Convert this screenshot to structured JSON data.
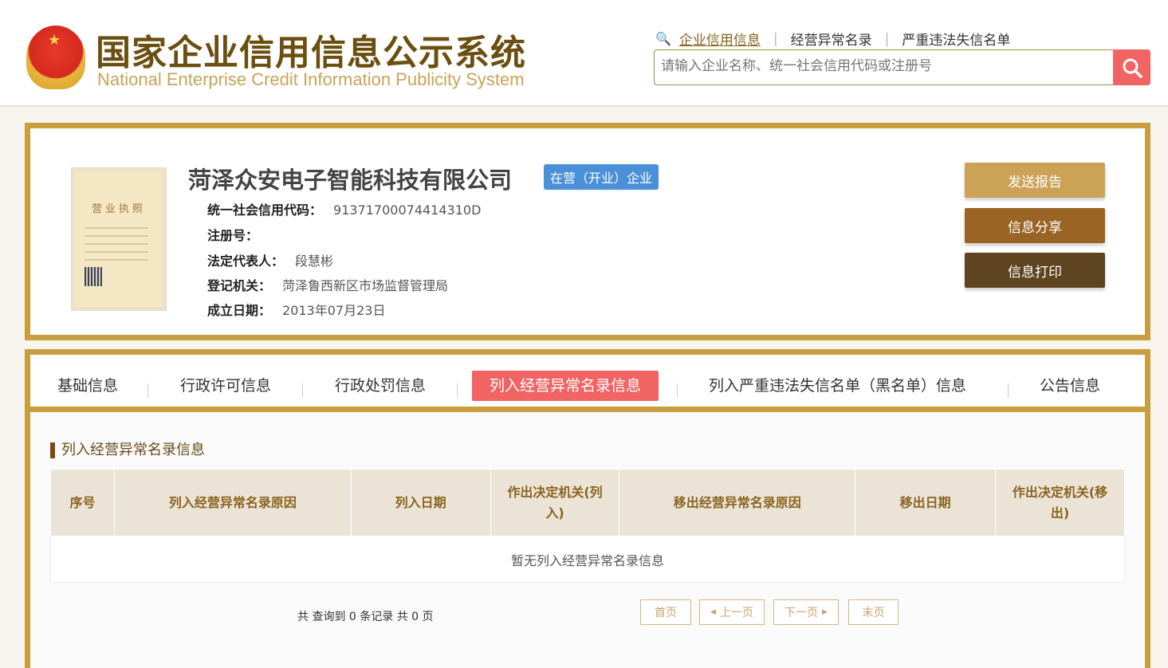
{
  "header": {
    "logo_cn": "国家企业信用信息公示系统",
    "logo_en": "National Enterprise Credit Information Publicity System",
    "nav": [
      "企业信用信息",
      "经营异常名录",
      "严重违法失信名单"
    ],
    "search_placeholder": "请输入企业名称、统一社会信用代码或注册号"
  },
  "company": {
    "license_title": "营业执照",
    "name": "菏泽众安电子智能科技有限公司",
    "status": "在营（开业）企业",
    "fields": [
      {
        "label": "统一社会信用代码：",
        "value": "91371700074414310D"
      },
      {
        "label": "注册号：",
        "value": ""
      },
      {
        "label": "法定代表人：",
        "value": "段慧彬"
      },
      {
        "label": "登记机关：",
        "value": "菏泽鲁西新区市场监督管理局"
      },
      {
        "label": "成立日期：",
        "value": "2013年07月23日"
      }
    ],
    "buttons": [
      "发送报告",
      "信息分享",
      "信息打印"
    ]
  },
  "tabs": [
    "基础信息",
    "行政许可信息",
    "行政处罚信息",
    "列入经营异常名录信息",
    "列入严重违法失信名单（黑名单）信息",
    "公告信息"
  ],
  "section": {
    "title": "列入经营异常名录信息",
    "columns": [
      "序号",
      "列入经营异常名录原因",
      "列入日期",
      "作出决定机关(列入)",
      "移出经营异常名录原因",
      "移出日期",
      "作出决定机关(移出)"
    ],
    "empty": "暂无列入经营异常名录信息",
    "count": "共 查询到 0 条记录 共 0 页",
    "pagination": [
      "首页",
      "上一页",
      "下一页",
      "末页"
    ]
  },
  "colors": {
    "gold": "#c99e3f",
    "accent": "#f06464",
    "badge": "#4a90d9"
  }
}
